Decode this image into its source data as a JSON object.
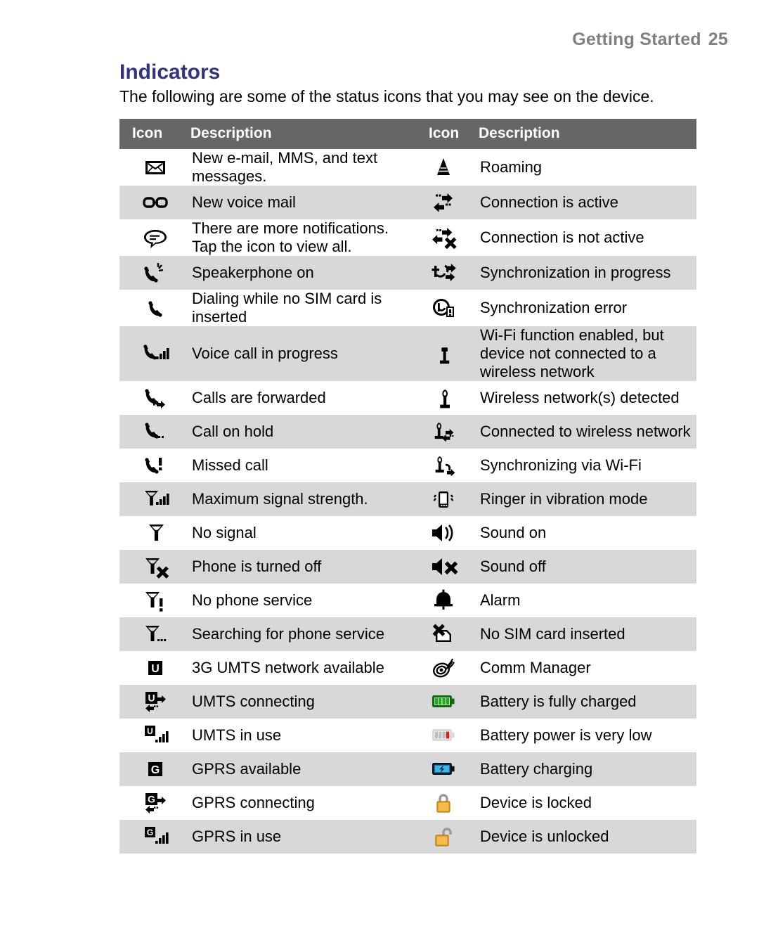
{
  "running_header": {
    "text": "Getting Started",
    "page": "25"
  },
  "section": {
    "title": "Indicators",
    "intro": "The following are some of the status icons that you may see on the device."
  },
  "table": {
    "headers": {
      "icon_left": "Icon",
      "description_left": "Description",
      "icon_right": "Icon",
      "description_right": "Description"
    },
    "colors": {
      "header_bg": "#666666",
      "row_alt_bg": "#d8d8d8",
      "row_bg": "#ffffff",
      "title_color": "#33337f",
      "running_header_color": "#808080"
    },
    "rows": [
      {
        "left": {
          "icon": "envelope-icon",
          "desc": "New e-mail, MMS, and text messages."
        },
        "right": {
          "icon": "roaming-triangle-icon",
          "desc": "Roaming"
        }
      },
      {
        "left": {
          "icon": "voicemail-icon",
          "desc": "New voice mail"
        },
        "right": {
          "icon": "connection-active-icon",
          "desc": "Connection is active"
        }
      },
      {
        "left": {
          "icon": "notification-bubble-icon",
          "desc": "There are more notifications. Tap the icon to view all."
        },
        "right": {
          "icon": "connection-inactive-icon",
          "desc": "Connection is not active"
        }
      },
      {
        "left": {
          "icon": "speakerphone-icon",
          "desc": "Speakerphone on"
        },
        "right": {
          "icon": "sync-in-progress-icon",
          "desc": "Synchronization in progress"
        }
      },
      {
        "left": {
          "icon": "dial-no-sim-icon",
          "desc": "Dialing while no SIM card is inserted"
        },
        "right": {
          "icon": "sync-error-icon",
          "desc": "Synchronization error"
        }
      },
      {
        "left": {
          "icon": "voice-call-progress-icon",
          "desc": "Voice call in progress"
        },
        "right": {
          "icon": "wifi-enabled-icon",
          "desc": "Wi-Fi function enabled, but device not connected to a wireless network"
        }
      },
      {
        "left": {
          "icon": "call-forwarded-icon",
          "desc": "Calls are forwarded"
        },
        "right": {
          "icon": "wifi-detected-icon",
          "desc": "Wireless network(s) detected"
        }
      },
      {
        "left": {
          "icon": "call-on-hold-icon",
          "desc": "Call on hold"
        },
        "right": {
          "icon": "wifi-connected-icon",
          "desc": "Connected to wireless network"
        }
      },
      {
        "left": {
          "icon": "missed-call-icon",
          "desc": "Missed call"
        },
        "right": {
          "icon": "wifi-syncing-icon",
          "desc": "Synchronizing via Wi-Fi"
        }
      },
      {
        "left": {
          "icon": "signal-max-icon",
          "desc": "Maximum signal strength."
        },
        "right": {
          "icon": "vibration-icon",
          "desc": "Ringer in vibration mode"
        }
      },
      {
        "left": {
          "icon": "no-signal-icon",
          "desc": "No signal"
        },
        "right": {
          "icon": "sound-on-icon",
          "desc": "Sound on"
        }
      },
      {
        "left": {
          "icon": "phone-off-icon",
          "desc": "Phone is turned off"
        },
        "right": {
          "icon": "sound-off-icon",
          "desc": "Sound off"
        }
      },
      {
        "left": {
          "icon": "no-phone-service-icon",
          "desc": "No phone service"
        },
        "right": {
          "icon": "alarm-bell-icon",
          "desc": "Alarm"
        }
      },
      {
        "left": {
          "icon": "searching-service-icon",
          "desc": "Searching for phone service"
        },
        "right": {
          "icon": "no-sim-card-icon",
          "desc": "No SIM card inserted"
        }
      },
      {
        "left": {
          "icon": "umts-available-icon",
          "desc": "3G UMTS network available"
        },
        "right": {
          "icon": "comm-manager-icon",
          "desc": "Comm Manager"
        }
      },
      {
        "left": {
          "icon": "umts-connecting-icon",
          "desc": "UMTS connecting"
        },
        "right": {
          "icon": "battery-full-icon",
          "desc": "Battery is fully charged"
        }
      },
      {
        "left": {
          "icon": "umts-in-use-icon",
          "desc": "UMTS in use"
        },
        "right": {
          "icon": "battery-low-icon",
          "desc": "Battery power is very low"
        }
      },
      {
        "left": {
          "icon": "gprs-available-icon",
          "desc": "GPRS available"
        },
        "right": {
          "icon": "battery-charging-icon",
          "desc": "Battery charging"
        }
      },
      {
        "left": {
          "icon": "gprs-connecting-icon",
          "desc": "GPRS connecting"
        },
        "right": {
          "icon": "device-locked-icon",
          "desc": "Device is locked"
        }
      },
      {
        "left": {
          "icon": "gprs-in-use-icon",
          "desc": "GPRS in use"
        },
        "right": {
          "icon": "device-unlocked-icon",
          "desc": "Device is unlocked"
        }
      }
    ]
  }
}
